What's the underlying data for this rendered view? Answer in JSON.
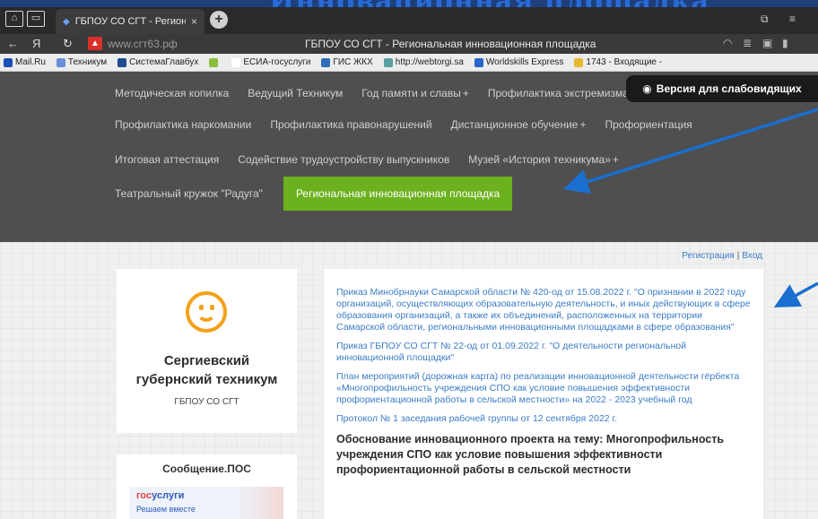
{
  "browser": {
    "tab_title": "ГБПОУ СО СГТ - Регион",
    "tab_close": "×",
    "new_tab": "+",
    "banner_text": "Инновационная площадка",
    "back": "←",
    "yandex": "Я",
    "reload": "↻",
    "warning": "▲",
    "url": "www.сгт63.рф",
    "page_title": "ГБПОУ СО СГТ - Региональная инновационная площадка"
  },
  "bookmarks": [
    {
      "label": "Mail.Ru",
      "color": "#1a4fb5"
    },
    {
      "label": "Техникум",
      "color": "#6a8ed8"
    },
    {
      "label": "СистемаГлавбух",
      "color": "#1d4b8f"
    },
    {
      "label": "",
      "color": "#8bbf3b"
    },
    {
      "label": "ЕСИА-госуслуги",
      "color": "#ffffff"
    },
    {
      "label": "ГИС ЖКХ",
      "color": "#2f6fb5"
    },
    {
      "label": "http://webtorgi.sa",
      "color": "#5aa0a0"
    },
    {
      "label": "Worldskills Express",
      "color": "#2a66c9"
    },
    {
      "label": "1743 - Входящие -",
      "color": "#e8b830"
    }
  ],
  "nav": {
    "row1": [
      "Методическая копилка",
      "Ведущий Техникум",
      "Год памяти и славы",
      "Профилактика экстремизма"
    ],
    "row1_plus": "+",
    "row2": [
      "Профилактика наркомании",
      "Профилактика правонарушений",
      "Дистанционное обучение",
      "Профориентация"
    ],
    "row3": [
      "Итоговая аттестация",
      "Содействие трудоустройству выпускников",
      "Музей «История техникума»"
    ],
    "row4_item": "Театральный кружок \"Радуга\"",
    "active": "Региональная инновационная площадка"
  },
  "vision_button": "Версия для слабовидящих",
  "auth": {
    "register": "Регистрация",
    "sep": "|",
    "login": "Вход"
  },
  "org": {
    "name_line1": "Сергиевский",
    "name_line2": "губернский техникум",
    "short": "ГБПОУ СО СГТ"
  },
  "pos": {
    "title": "Сообщение.ПОС",
    "gos_a": "гос",
    "gos_b": "услуги",
    "sub": "Решаем вместе"
  },
  "documents": [
    "Приказ Минобрнауки Самарской области № 420-од от 15.08.2022 г. \"О признании в 2022 году организаций, осуществляющих образовательную деятельность, и иных действующих в сфере образования организаций, а также их объединений, расположенных на территории Самарской области, региональными инновационными площадками в сфере образования\"",
    "Приказ ГБПОУ СО СГТ № 22-од от 01.09.2022 г. \"О деятельности региональной инновационной площадки\"",
    "План мероприятий (дорожная карта) по реализации инновационной деятельности гёрбекта «Многопрофильность учреждения СПО как условие повышения эффективности профориентационной работы в сельской местности» на 2022 - 2023 учебный год",
    "Протокол № 1 заседания рабочей группы от 12 сентября 2022 г."
  ],
  "section_title": "Обоснование инновационного проекта на тему: Многопрофильность учреждения СПО как условие повышения эффективности профориентационной работы в сельской местности",
  "colors": {
    "accent": "#6cb11e",
    "link": "#3b7cc6",
    "arrow": "#1a6fd0",
    "logo": "#f2a31c"
  }
}
